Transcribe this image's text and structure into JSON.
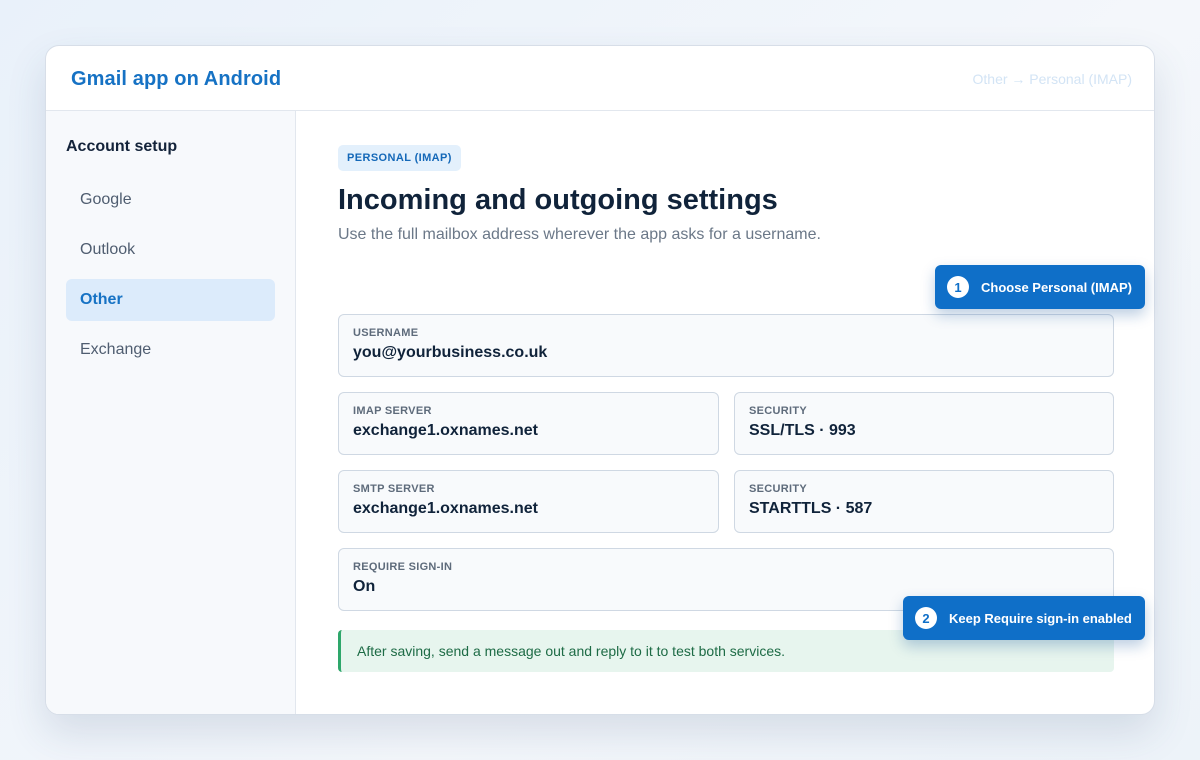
{
  "header": {
    "title": "Gmail app on Android",
    "breadcrumb": "Other → Personal (IMAP)"
  },
  "sidebar": {
    "heading": "Account setup",
    "items": [
      {
        "label": "Google",
        "active": false
      },
      {
        "label": "Outlook",
        "active": false
      },
      {
        "label": "Other",
        "active": true
      },
      {
        "label": "Exchange",
        "active": false
      }
    ]
  },
  "main": {
    "badge": "PERSONAL (IMAP)",
    "title": "Incoming and outgoing settings",
    "subtitle": "Use the full mailbox address wherever the app asks for a username.",
    "fields": {
      "username": {
        "label": "USERNAME",
        "value": "you@yourbusiness.co.uk"
      },
      "imap_server": {
        "label": "IMAP SERVER",
        "value": "exchange1.oxnames.net"
      },
      "imap_security": {
        "label": "SECURITY",
        "value": "SSL/TLS · 993"
      },
      "smtp_server": {
        "label": "SMTP SERVER",
        "value": "exchange1.oxnames.net"
      },
      "smtp_security": {
        "label": "SECURITY",
        "value": "STARTTLS · 587"
      },
      "require_signin": {
        "label": "REQUIRE SIGN-IN",
        "value": "On"
      }
    },
    "notice": "After saving, send a message out and reply to it to test both services."
  },
  "callouts": [
    {
      "number": "1",
      "text": "Choose Personal (IMAP)"
    },
    {
      "number": "2",
      "text": "Keep Require sign-in enabled"
    }
  ],
  "colors": {
    "accent": "#1672c4",
    "callout": "#0f6fc8",
    "notice_border": "#2ea76b",
    "active_nav_bg": "#dcebfb"
  }
}
